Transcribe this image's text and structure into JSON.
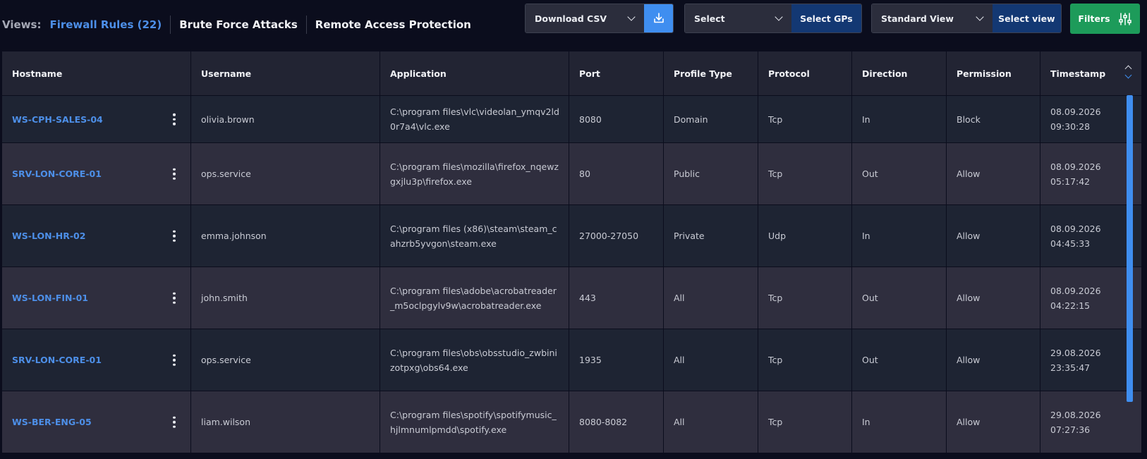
{
  "views": {
    "label": "Views:",
    "tabs": [
      "Firewall Rules (22)",
      "Brute Force Attacks",
      "Remote Access Protection"
    ]
  },
  "controls": {
    "download_label": "Download CSV",
    "gp_select_value": "Select",
    "gp_button_label": "Select GPs",
    "view_select_value": "Standard View",
    "view_button_label": "Select view",
    "filters_label": "Filters"
  },
  "table": {
    "columns": [
      "Hostname",
      "Username",
      "Application",
      "Port",
      "Profile Type",
      "Protocol",
      "Direction",
      "Permission",
      "Timestamp"
    ],
    "sorted_column": "Timestamp",
    "rows": [
      {
        "hostname": "WS-CPH-SALES-04",
        "username": "olivia.brown",
        "application": "C:\\program files\\vlc\\videolan_ymqv2ld0r7a4\\vlc.exe",
        "port": "8080",
        "profile": "Domain",
        "protocol": "Tcp",
        "direction": "In",
        "permission": "Block",
        "timestamp": "08.09.2026 09:30:28"
      },
      {
        "hostname": "SRV-LON-CORE-01",
        "username": "ops.service",
        "application": "C:\\program files\\mozilla\\firefox_nqewzgxjlu3p\\firefox.exe",
        "port": "80",
        "profile": "Public",
        "protocol": "Tcp",
        "direction": "Out",
        "permission": "Allow",
        "timestamp": "08.09.2026 05:17:42"
      },
      {
        "hostname": "WS-LON-HR-02",
        "username": "emma.johnson",
        "application": "C:\\program files (x86)\\steam\\steam_cahzrb5yvgon\\steam.exe",
        "port": "27000-27050",
        "profile": "Private",
        "protocol": "Udp",
        "direction": "In",
        "permission": "Allow",
        "timestamp": "08.09.2026 04:45:33"
      },
      {
        "hostname": "WS-LON-FIN-01",
        "username": "john.smith",
        "application": "C:\\program files\\adobe\\acrobatreader_m5oclpgylv9w\\acrobatreader.exe",
        "port": "443",
        "profile": "All",
        "protocol": "Tcp",
        "direction": "Out",
        "permission": "Allow",
        "timestamp": "08.09.2026 04:22:15"
      },
      {
        "hostname": "SRV-LON-CORE-01",
        "username": "ops.service",
        "application": "C:\\program files\\obs\\obsstudio_zwbinizotpxg\\obs64.exe",
        "port": "1935",
        "profile": "All",
        "protocol": "Tcp",
        "direction": "Out",
        "permission": "Allow",
        "timestamp": "29.08.2026 23:35:47"
      },
      {
        "hostname": "WS-BER-ENG-05",
        "username": "liam.wilson",
        "application": "C:\\program files\\spotify\\spotifymusic_hjlmnumlpmdd\\spotify.exe",
        "port": "8080-8082",
        "profile": "All",
        "protocol": "Tcp",
        "direction": "In",
        "permission": "Allow",
        "timestamp": "29.08.2026 07:27:36"
      }
    ]
  },
  "colors": {
    "accent": "#4d8fe8",
    "background": "#0b0d1d",
    "button_navy": "#133873",
    "filters_green": "#1d9b5a"
  }
}
